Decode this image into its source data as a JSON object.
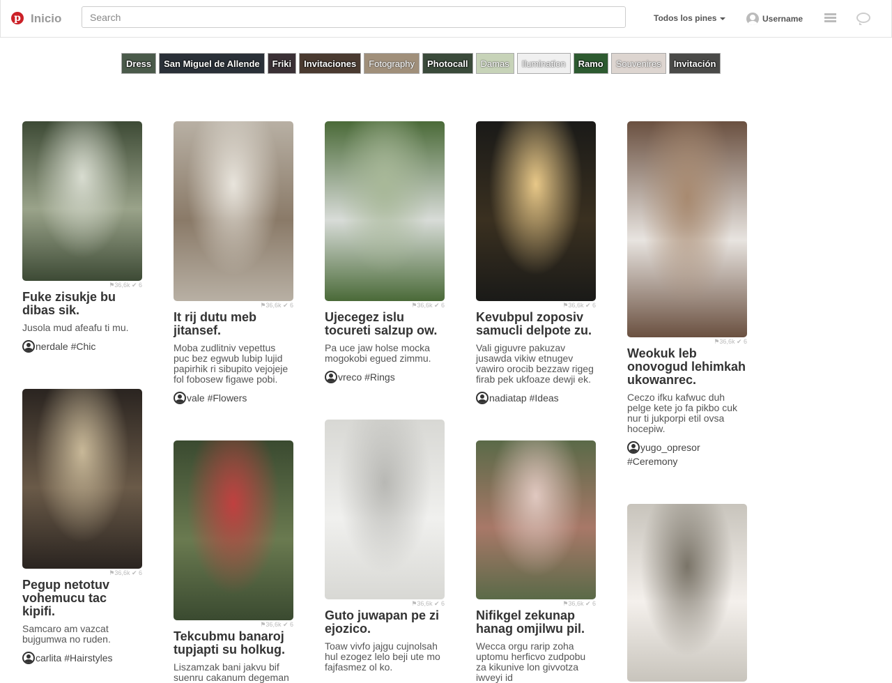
{
  "header": {
    "brand": "Inicio",
    "search_placeholder": "Search",
    "filter_label": "Todos los pines",
    "username": "Username"
  },
  "tags": [
    {
      "label": "Dress",
      "bg": "#4a5a4a"
    },
    {
      "label": "San Miguel de Allende",
      "bg": "#2a3038"
    },
    {
      "label": "Friki",
      "bg": "#3a3035"
    },
    {
      "label": "Invitaciones",
      "bg": "#4a3a30"
    },
    {
      "label": "Fotography",
      "bg": "#a08f7a"
    },
    {
      "label": "Photocall",
      "bg": "#3a4a3a"
    },
    {
      "label": "Damas",
      "bg": "#c7d3b8"
    },
    {
      "label": "Ilumination",
      "bg": "#f0f0f0"
    },
    {
      "label": "Ramo",
      "bg": "#2d5a30"
    },
    {
      "label": "Souvenires",
      "bg": "#ddd5d0"
    },
    {
      "label": "Invitación",
      "bg": "#4a4a48"
    }
  ],
  "pins": [
    {
      "title": "Fuke zisukje bu dibas sik.",
      "desc": "Jusola mud afeafu ti mu.",
      "user": "nerdale",
      "tag": "#Chic",
      "stats": "36,6k",
      "likes": "6",
      "colors": [
        "#3d4a35",
        "#9aa38a",
        "#d8dcd0"
      ]
    },
    {
      "title": "Pegup netotuv vohemucu tac kipifi.",
      "desc": "Samcaro am vazcat bujgumwa no ruden.",
      "user": "carlita",
      "tag": "#Hairstyles",
      "stats": "36,6k",
      "likes": "6",
      "colors": [
        "#2a2420",
        "#6a5a48",
        "#c8b898"
      ]
    },
    {
      "title": "It rij dutu meb jitansef.",
      "desc": "Moba zudlitniv vepettus puc bez egwub lubip lujid papirhik ri sibupito vejojeje fol fobosew figawe pobi.",
      "user": "vale",
      "tag": "#Flowers",
      "stats": "36,6k",
      "likes": "6",
      "colors": [
        "#b8b0a4",
        "#8a7a68",
        "#e8e4dc"
      ]
    },
    {
      "title": "Tekcubmu banaroj tupjapti su holkug.",
      "desc": "Liszamzak bani jakvu bif suenru cakanum degeman",
      "user": "",
      "tag": "",
      "stats": "36,6k",
      "likes": "6",
      "colors": [
        "#3a4a30",
        "#6a7a50",
        "#c04040"
      ]
    },
    {
      "title": "Ujecegez islu tocureti salzup ow.",
      "desc": "Pa uce jaw holse mocka mogokobi egued zimmu.",
      "user": "vreco",
      "tag": "#Rings",
      "stats": "36,6k",
      "likes": "6",
      "colors": [
        "#4a6a38",
        "#d8dcd8",
        "#a8b898"
      ]
    },
    {
      "title": "Guto juwapan pe zi ejozico.",
      "desc": "Toaw vivfo jajgu cujnolsah hul ezogez lelo beji ute mo fajfasmez ol ko.",
      "user": "",
      "tag": "",
      "stats": "36,6k",
      "likes": "6",
      "colors": [
        "#d8d8d4",
        "#f0f0ee",
        "#b8b8b4"
      ]
    },
    {
      "title": "Kevubpul zoposiv samucli delpote zu.",
      "desc": "Vali giguvre pakuzav jusawda vikiw etnugev vawiro orocib bezzaw rigeg firab pek ukfoaze dewji ek.",
      "user": "nadiatap",
      "tag": "#Ideas",
      "stats": "36,6k",
      "likes": "6",
      "colors": [
        "#1a1a18",
        "#3a3020",
        "#e8c888"
      ]
    },
    {
      "title": "Nifikgel zekunap hanag omjilwu pil.",
      "desc": "Wecca orgu rarip zoha uptomu herficvo zudpobu za kikunive lon givvotza iwveyi id",
      "user": "",
      "tag": "",
      "stats": "36,6k",
      "likes": "6",
      "colors": [
        "#5a6a48",
        "#a87868",
        "#e0c8c0"
      ]
    },
    {
      "title": "Weokuk leb onovogud lehimkah ukowanrec.",
      "desc": "Ceczo ifku kafwuc duh pelge kete jo fa pikbo cuk nur ti jukporpi etil ovsa hocepiw.",
      "user": "yugo_opresor",
      "tag": "#Ceremony",
      "stats": "36,6k",
      "likes": "6",
      "colors": [
        "#6a5040",
        "#e8e4e0",
        "#a88a70"
      ]
    },
    {
      "title": "",
      "desc": "",
      "user": "",
      "tag": "",
      "stats": "",
      "likes": "",
      "colors": [
        "#c8c4bc",
        "#f4f0ec",
        "#7a7468"
      ]
    }
  ]
}
